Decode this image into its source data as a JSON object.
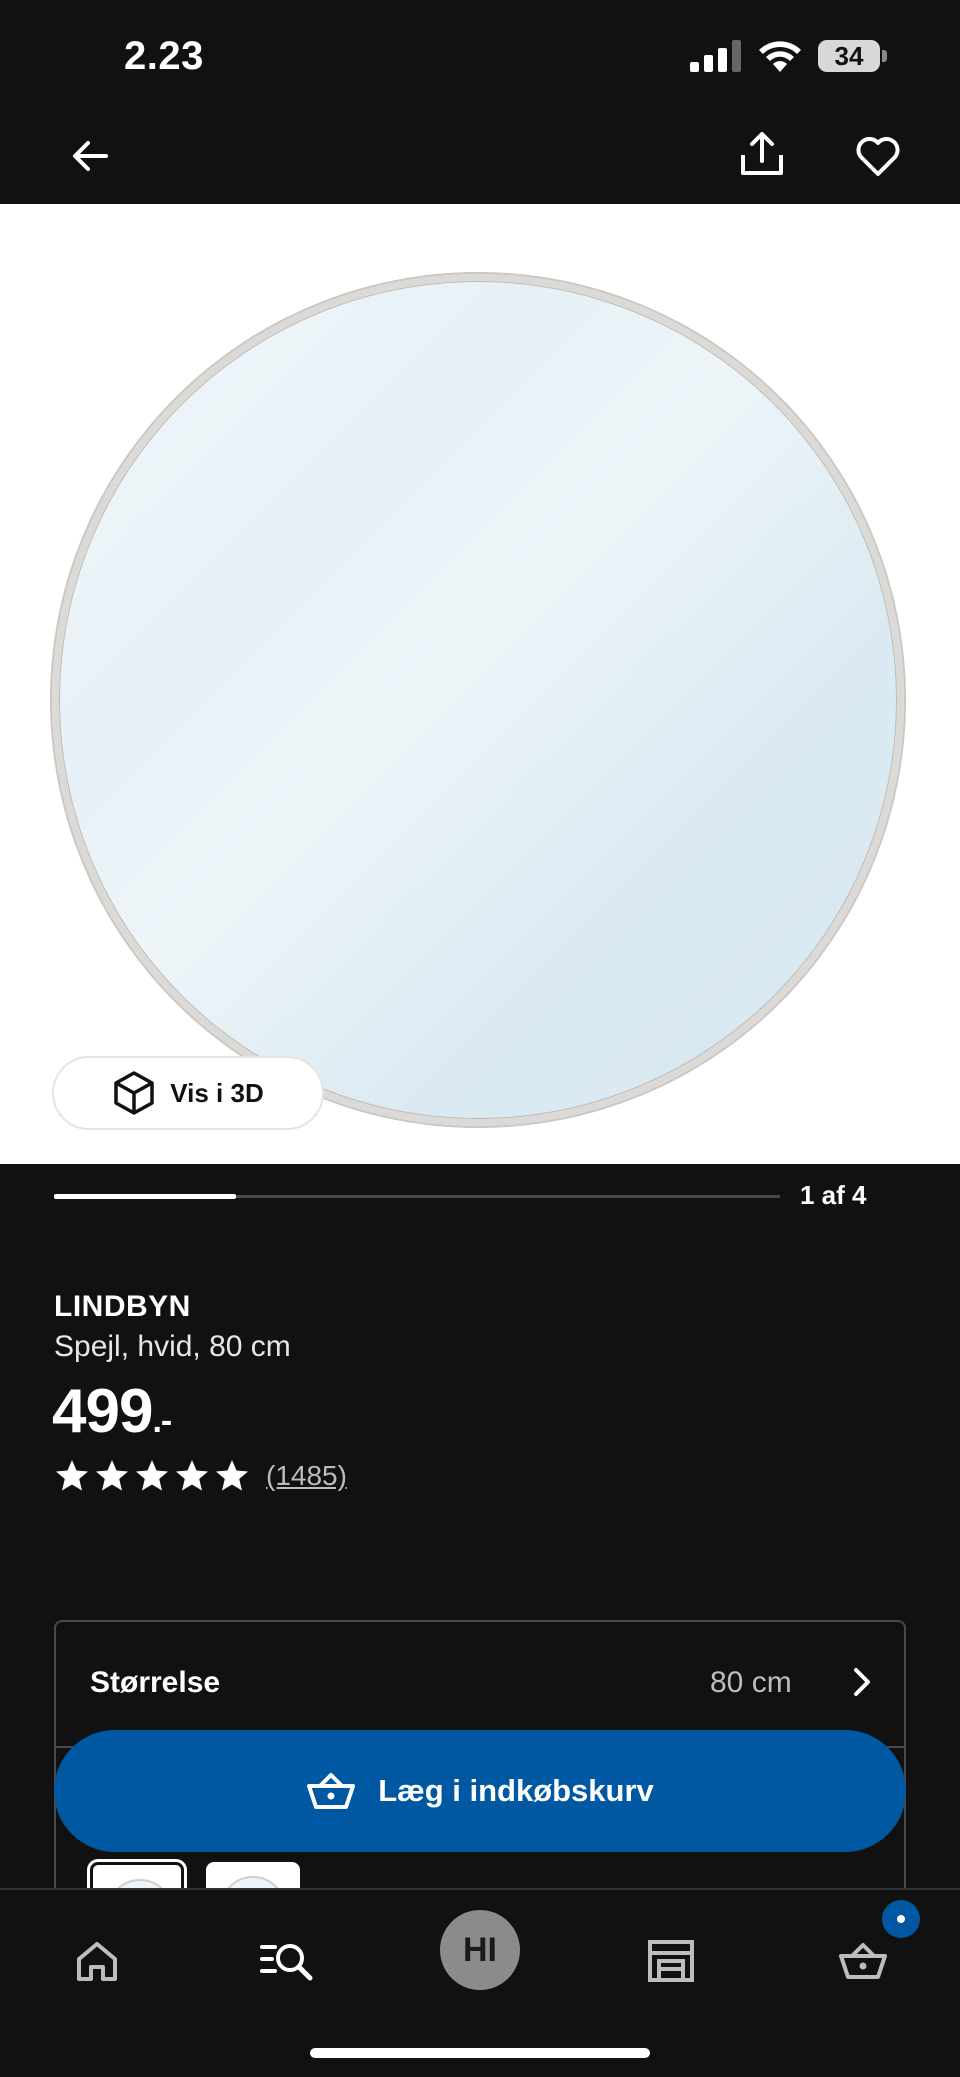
{
  "status_bar": {
    "time": "2.23",
    "battery_level": "34"
  },
  "top_nav": {
    "back_icon": "arrow-left-icon",
    "share_icon": "share-upload-icon",
    "favorite_icon": "heart-icon"
  },
  "gallery": {
    "view_3d_label": "Vis i 3D",
    "view_3d_icon": "cube-3d-icon",
    "pager_label": "1 af 4",
    "current_image": 1,
    "total_images": 4
  },
  "product": {
    "brand": "LINDBYN",
    "description": "Spejl, hvid, 80 cm",
    "price": "499",
    "price_suffix": ".-",
    "rating_stars": 5,
    "rating_count": "(1485)"
  },
  "size_selector": {
    "label": "Størrelse",
    "value": "80 cm"
  },
  "cta": {
    "add_to_basket_label": "Læg i indkøbskurv",
    "basket_icon": "basket-icon",
    "color": "#0058a3"
  },
  "tab_bar": {
    "home_icon": "home-icon",
    "search_icon": "search-list-icon",
    "profile_initials": "HI",
    "stores_icon": "store-icon",
    "basket_icon": "basket-icon"
  }
}
